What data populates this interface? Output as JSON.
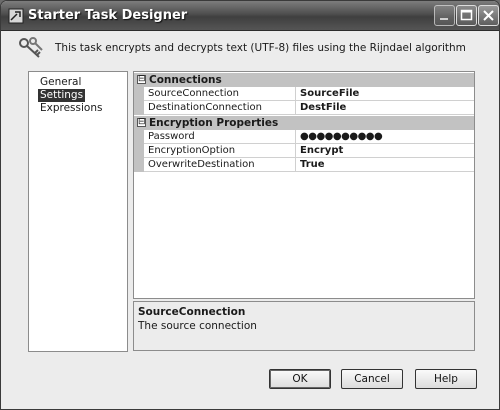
{
  "window": {
    "title": "Starter Task Designer",
    "controls": [
      "minimize-icon",
      "maximize-icon",
      "close-icon"
    ]
  },
  "header": {
    "icon": "keys-icon",
    "description": "This task encrypts and decrypts text (UTF-8) files using the Rijndael algorithm"
  },
  "nav": {
    "items": [
      {
        "label": "General",
        "selected": false
      },
      {
        "label": "Settings",
        "selected": true
      },
      {
        "label": "Expressions",
        "selected": false
      }
    ]
  },
  "properties": {
    "categories": [
      {
        "label": "Connections",
        "toggle": "⊟",
        "rows": [
          {
            "name": "SourceConnection",
            "value": "SourceFile"
          },
          {
            "name": "DestinationConnection",
            "value": "DestFile"
          }
        ]
      },
      {
        "label": "Encryption Properties",
        "toggle": "⊟",
        "rows": [
          {
            "name": "Password",
            "value": "●●●●●●●●●●"
          },
          {
            "name": "EncryptionOption",
            "value": "Encrypt"
          },
          {
            "name": "OverwriteDestination",
            "value": "True"
          }
        ]
      }
    ]
  },
  "description_panel": {
    "title": "SourceConnection",
    "text": "The source connection"
  },
  "buttons": {
    "ok": "OK",
    "cancel": "Cancel",
    "help": "Help"
  }
}
